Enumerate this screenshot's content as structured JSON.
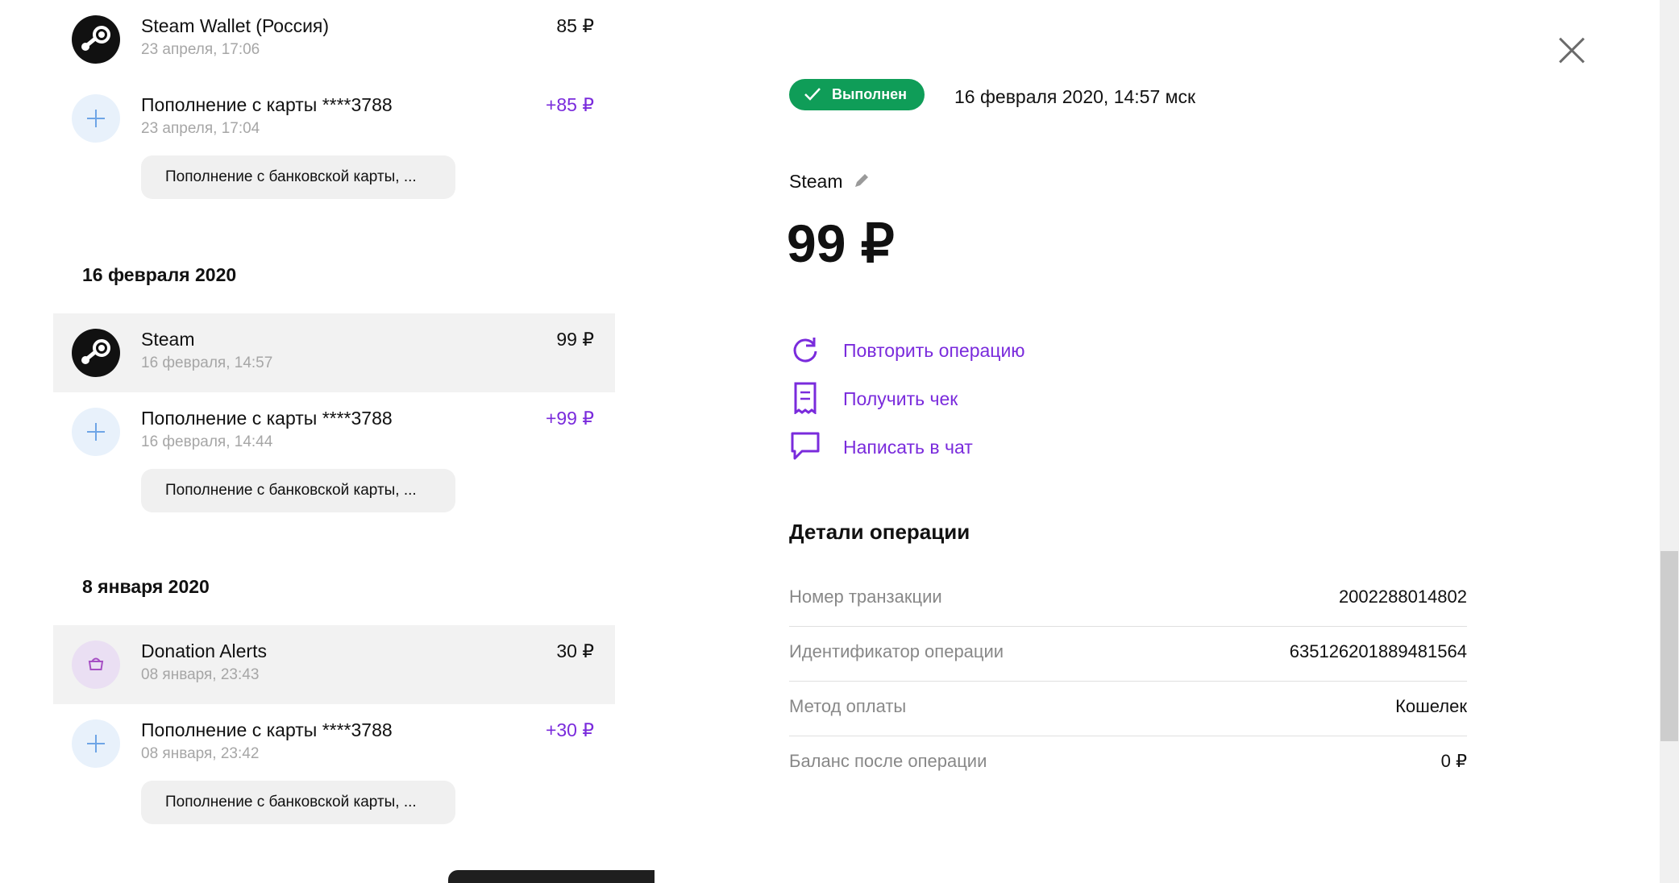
{
  "history": {
    "groups": [
      {
        "date": "",
        "items": [
          {
            "title": "Steam Wallet (Россия)",
            "time": "23 апреля, 17:06",
            "amount": "85 ₽",
            "icon": "steam-icon",
            "incoming": false
          },
          {
            "title": "Пополнение с карты ****3788",
            "time": "23 апреля, 17:04",
            "amount": "+85 ₽",
            "icon": "plus-icon",
            "incoming": true,
            "comment": "Пополнение с банковской карты, ..."
          }
        ]
      },
      {
        "date": "16 февраля 2020",
        "items": [
          {
            "title": "Steam",
            "time": "16 февраля, 14:57",
            "amount": "99 ₽",
            "icon": "steam-icon",
            "incoming": false,
            "selected": true
          },
          {
            "title": "Пополнение с карты ****3788",
            "time": "16 февраля, 14:44",
            "amount": "+99 ₽",
            "icon": "plus-icon",
            "incoming": true,
            "comment": "Пополнение с банковской карты, ..."
          }
        ]
      },
      {
        "date": "8 января 2020",
        "items": [
          {
            "title": "Donation Alerts",
            "time": "08 января, 23:43",
            "amount": "30 ₽",
            "icon": "shopping-bag-icon",
            "incoming": false,
            "selected": true
          },
          {
            "title": "Пополнение с карты ****3788",
            "time": "08 января, 23:42",
            "amount": "+30 ₽",
            "icon": "plus-icon",
            "incoming": true,
            "comment": "Пополнение с банковской карты, ..."
          }
        ]
      }
    ]
  },
  "detail": {
    "status": "Выполнен",
    "status_color": "#0f9d58",
    "datetime": "16 февраля 2020, 14:57 мск",
    "merchant": "Steam",
    "amount": "99 ₽",
    "actions": [
      {
        "label": "Повторить операцию",
        "icon": "repeat-icon"
      },
      {
        "label": "Получить чек",
        "icon": "receipt-icon"
      },
      {
        "label": "Написать в чат",
        "icon": "chat-icon"
      }
    ],
    "details_title": "Детали операции",
    "rows": [
      {
        "label": "Номер транзакции",
        "value": "2002288014802"
      },
      {
        "label": "Идентификатор операции",
        "value": "635126201889481564"
      },
      {
        "label": "Метод оплаты",
        "value": "Кошелек"
      },
      {
        "label": "Баланс после операции",
        "value": "0 ₽"
      }
    ]
  },
  "colors": {
    "accent": "#7a2bdc",
    "success": "#0f9d58"
  }
}
